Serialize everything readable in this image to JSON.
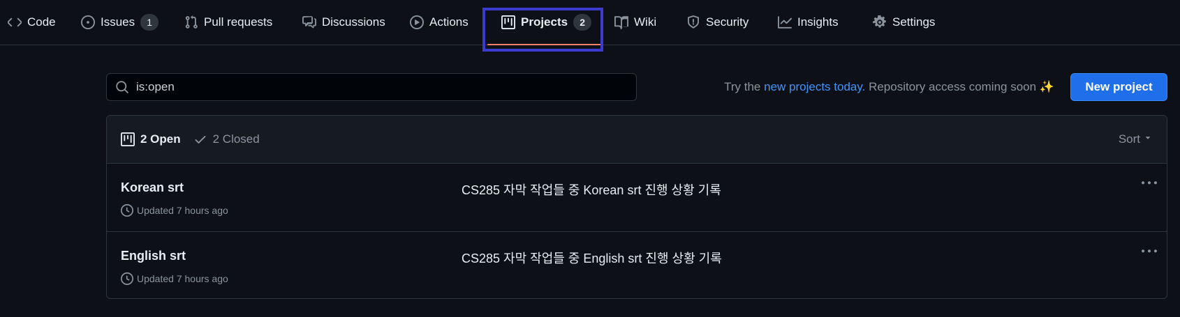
{
  "nav": {
    "tabs": [
      {
        "label": "Code",
        "icon": "code-icon"
      },
      {
        "label": "Issues",
        "icon": "issue-opened-icon",
        "count": "1"
      },
      {
        "label": "Pull requests",
        "icon": "git-pull-request-icon"
      },
      {
        "label": "Discussions",
        "icon": "comment-discussion-icon"
      },
      {
        "label": "Actions",
        "icon": "play-icon"
      },
      {
        "label": "Projects",
        "icon": "table-icon",
        "count": "2",
        "selected": true
      },
      {
        "label": "Wiki",
        "icon": "book-icon"
      },
      {
        "label": "Security",
        "icon": "shield-icon"
      },
      {
        "label": "Insights",
        "icon": "graph-icon"
      },
      {
        "label": "Settings",
        "icon": "gear-icon"
      }
    ]
  },
  "search": {
    "value": "is:open"
  },
  "promo": {
    "prefix": "Try the",
    "link": "new projects today.",
    "suffix": "Repository access coming soon",
    "emoji": "✨"
  },
  "new_project_label": "New project",
  "list": {
    "open_label": "2 Open",
    "closed_label": "2 Closed",
    "sort_label": "Sort",
    "projects": [
      {
        "title": "Korean srt",
        "updated": "Updated 7 hours ago",
        "description": "CS285 자막 작업들 중 Korean srt 진행 상황 기록"
      },
      {
        "title": "English srt",
        "updated": "Updated 7 hours ago",
        "description": "CS285 자막 작업들 중 English srt 진행 상황 기록"
      }
    ]
  },
  "colors": {
    "background": "#0d1117",
    "accent": "#1f6feb",
    "link": "#4493f8",
    "selected_underline": "#f78166",
    "highlight_box": "#3b3bd0"
  }
}
